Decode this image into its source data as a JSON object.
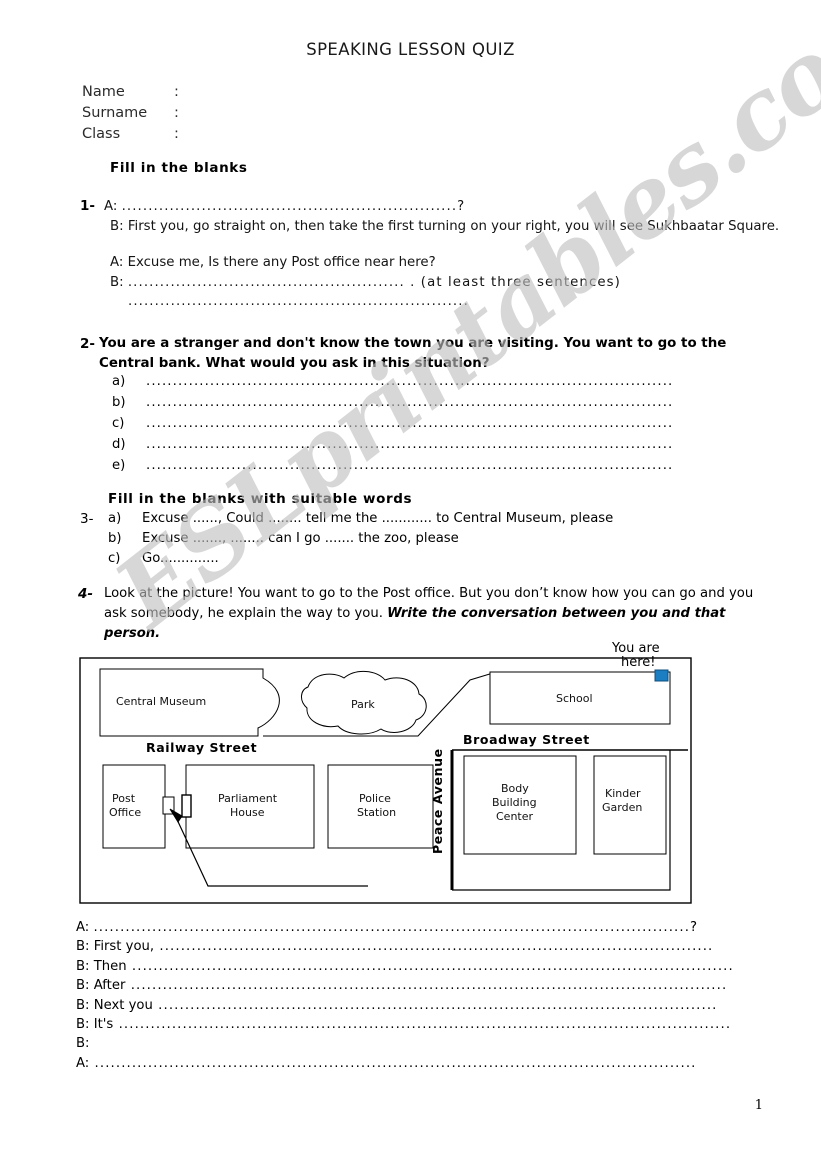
{
  "document": {
    "title": "SPEAKING LESSON QUIZ",
    "page_number": "1",
    "watermark": "ESLprintables.com"
  },
  "student_info": {
    "name_label": "Name",
    "surname_label": "Surname",
    "class_label": "Class",
    "colon": ":",
    "name_value": "",
    "surname_value": "",
    "class_value": ""
  },
  "headings": {
    "fill_in_the_blanks": "Fill in the blanks",
    "fill_in_the_blanks_suitable": "Fill in the blanks with suitable words"
  },
  "question1": {
    "number": "1-",
    "a_prefix": "A:",
    "a_dots": "...............................................................?",
    "b_prefix": "B:",
    "b_text": "First you, go straight on, then  take the first turning on your right, you will see Sukhbaatar Square.",
    "a2_prefix": "A:",
    "a2_text": "Excuse me, Is there any Post office near here?",
    "b2_prefix": "B:",
    "b2_dots": ".................................................... . (at least three sentences)",
    "b3_dots": "................................................................"
  },
  "question2": {
    "number": "2-",
    "prompt": "You are a stranger and don't know the town you are visiting. You want to go to the Central bank. What would you ask in this situation?",
    "items": [
      {
        "letter": "a)",
        "dots": "..................................................................................................."
      },
      {
        "letter": "b)",
        "dots": "..................................................................................................."
      },
      {
        "letter": "c)",
        "dots": "..................................................................................................."
      },
      {
        "letter": "d)",
        "dots": "..................................................................................................."
      },
      {
        "letter": "e)",
        "dots": "..................................................................................................."
      }
    ]
  },
  "question3": {
    "number": "3-",
    "items": [
      {
        "letter": "a)",
        "text": "Excuse ......, Could ........ tell  me the  ............ to Central Museum, please"
      },
      {
        "letter": "b)",
        "text": "Excuse ......., ........ can I  go  ....... the zoo, please"
      },
      {
        "letter": "c)",
        "text": "Go.............."
      }
    ]
  },
  "question4": {
    "number": "4-",
    "text_part1": "Look at the picture! You want to go to the Post office. But you don’t know how you can go and you ask somebody, he explain the way to you. ",
    "text_emphasis": "Write the  conversation between you and that person."
  },
  "map": {
    "marker_label_line1": "You are",
    "marker_label_line2": "here!",
    "marker_color": "#1b7ec2",
    "buildings": [
      {
        "name": "Central Museum",
        "label": "Central Museum"
      },
      {
        "name": "Park",
        "label": "Park"
      },
      {
        "name": "School",
        "label": "School"
      },
      {
        "name": "Post Office",
        "label_line1": "Post",
        "label_line2": "Office"
      },
      {
        "name": "Parliament House",
        "label_line1": "Parliament",
        "label_line2": "House"
      },
      {
        "name": "Police Station",
        "label_line1": "Police",
        "label_line2": "Station"
      },
      {
        "name": "Body Building Center",
        "label_line1": "Body",
        "label_line2": "Building",
        "label_line3": "Center"
      },
      {
        "name": "Kinder Garden",
        "label_line1": "Kinder",
        "label_line2": "Garden"
      }
    ],
    "streets": [
      {
        "name": "Railway Street",
        "label": "Railway Street"
      },
      {
        "name": "Broadway Street",
        "label": "Broadway Street"
      },
      {
        "name": "Peace Avenue",
        "label": "Peace Avenue"
      }
    ]
  },
  "conversation": [
    {
      "speaker": "A:",
      "text": " ",
      "dots": "................................................................................................................?"
    },
    {
      "speaker": "B:",
      "text": "First you,",
      "dots": " ........................................................................................................"
    },
    {
      "speaker": "B:",
      "text": "Then",
      "dots": " ................................................................................................................."
    },
    {
      "speaker": "B:",
      "text": "After",
      "dots": " ................................................................................................................"
    },
    {
      "speaker": "B:",
      "text": "Next you",
      "dots": " ........................................................................................................."
    },
    {
      "speaker": "B:",
      "text": "It's",
      "dots": " ..................................................................................................................."
    },
    {
      "speaker": "B:",
      "text": "",
      "dots": ""
    },
    {
      "speaker": "A:",
      "text": "",
      "dots": " ................................................................................................................."
    }
  ]
}
